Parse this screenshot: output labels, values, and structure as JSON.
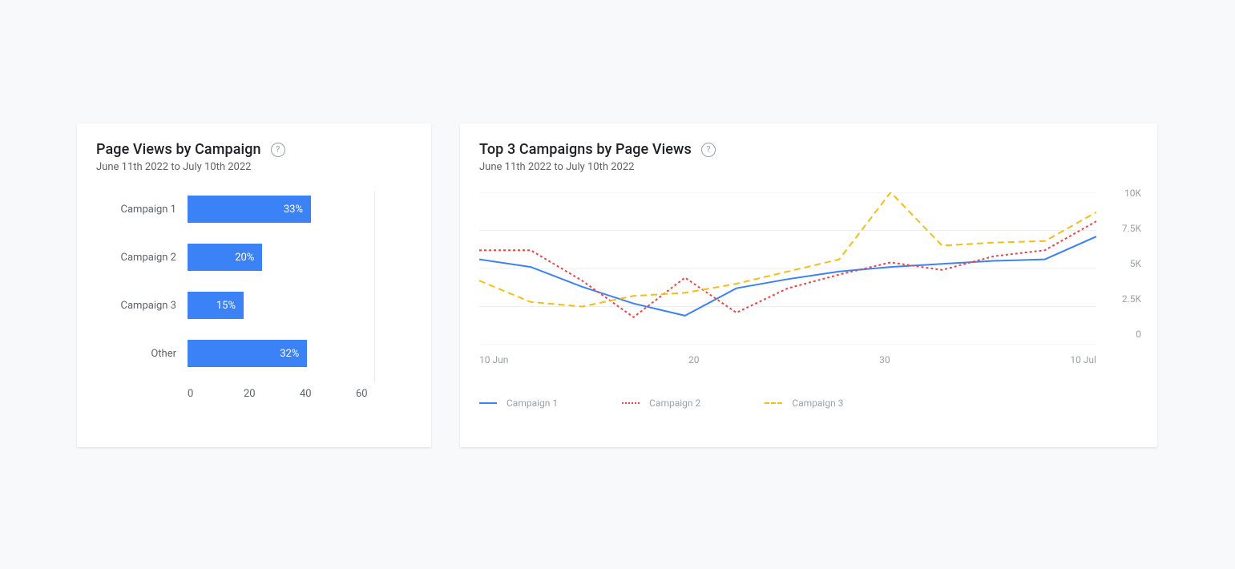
{
  "chart_data": [
    {
      "type": "bar",
      "orientation": "horizontal",
      "title": "Page Views by Campaign",
      "subtitle": "June 11th 2022 to July 10th 2022",
      "categories": [
        "Campaign 1",
        "Campaign 2",
        "Campaign 3",
        "Other"
      ],
      "values": [
        33,
        20,
        15,
        32
      ],
      "value_labels": [
        "33%",
        "20%",
        "15%",
        "32%"
      ],
      "xlabel": "",
      "ylabel": "",
      "xlim": [
        0,
        60
      ],
      "x_ticks": [
        "0",
        "20",
        "40",
        "60"
      ],
      "bar_color": "#3b82f6"
    },
    {
      "type": "line",
      "title": "Top 3 Campaigns by Page Views",
      "subtitle": "June 11th 2022 to July 10th 2022",
      "x_ticks": [
        "10 Jun",
        "20",
        "30",
        "10 Jul"
      ],
      "y_ticks": [
        "10K",
        "7.5K",
        "5K",
        "2.5K",
        "0"
      ],
      "ylim": [
        0,
        10000
      ],
      "series": [
        {
          "name": "Campaign 1",
          "color": "#3b82f6",
          "style": "solid",
          "values": [
            5600,
            5100,
            3800,
            2700,
            1900,
            3700,
            4300,
            4800,
            5100,
            5300,
            5500,
            5600,
            7100
          ]
        },
        {
          "name": "Campaign 2",
          "color": "#ef4444",
          "style": "dashed-fine",
          "values": [
            6200,
            6200,
            4200,
            1800,
            4400,
            2100,
            3700,
            4600,
            5400,
            4900,
            5800,
            6200,
            8100
          ]
        },
        {
          "name": "Campaign 3",
          "color": "#f5bd16",
          "style": "dashed",
          "values": [
            4200,
            2800,
            2500,
            3200,
            3400,
            4000,
            4800,
            5600,
            10000,
            6500,
            6700,
            6800,
            8700
          ]
        }
      ]
    }
  ]
}
